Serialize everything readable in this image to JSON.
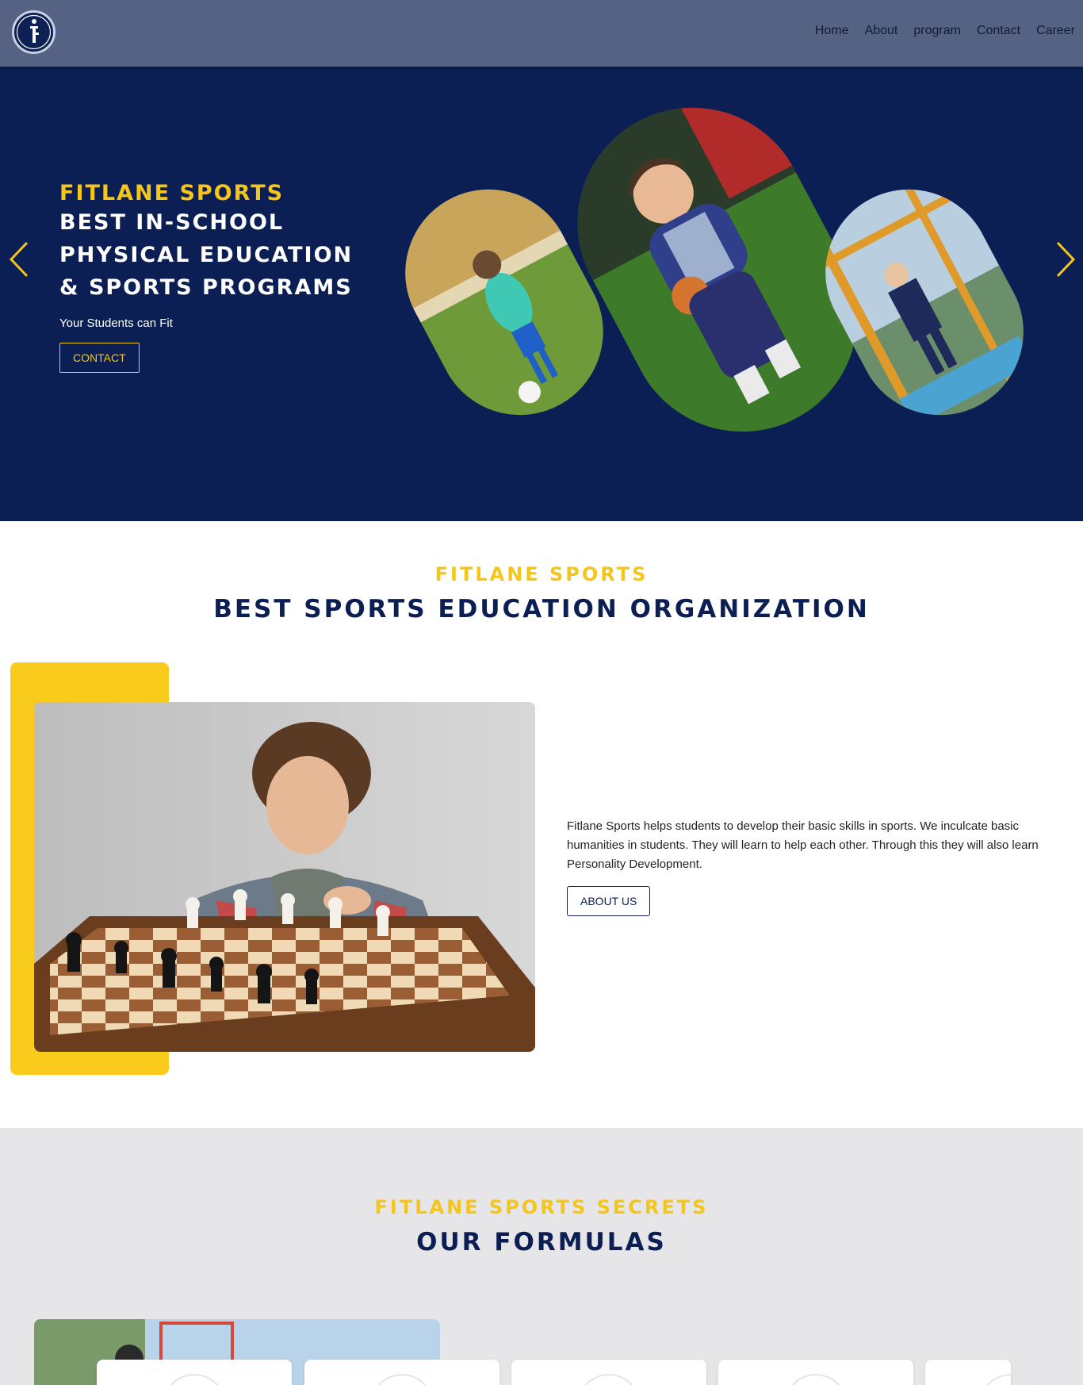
{
  "brand": {
    "logo_icon": "fitlane-logo-icon",
    "primary_color": "#0c1f54",
    "accent_color": "#f5c518",
    "nav_bg": "#566283"
  },
  "nav": {
    "items": [
      {
        "label": "Home"
      },
      {
        "label": "About"
      },
      {
        "label": "program"
      },
      {
        "label": "Contact"
      },
      {
        "label": "Career"
      }
    ]
  },
  "hero": {
    "eyebrow": "Fitlane Sports",
    "title_lines": [
      "Best In-School",
      "Physical Education",
      "& Sports Programs"
    ],
    "subtitle": "Your Students can Fit",
    "cta_label": "CONTACT",
    "prev_icon": "chevron-left-icon",
    "next_icon": "chevron-right-icon"
  },
  "about": {
    "eyebrow": "Fitlane Sports",
    "title": "Best Sports Education Organization",
    "description": "Fitlane Sports helps students to develop their basic skills in sports. We inculcate basic humanities in students. They will learn to help each other. Through this they will also learn Personality Development.",
    "cta_label": "ABOUT US"
  },
  "formulas": {
    "eyebrow": "Fitlane Sports Secrets",
    "title": "Our Formulas"
  }
}
